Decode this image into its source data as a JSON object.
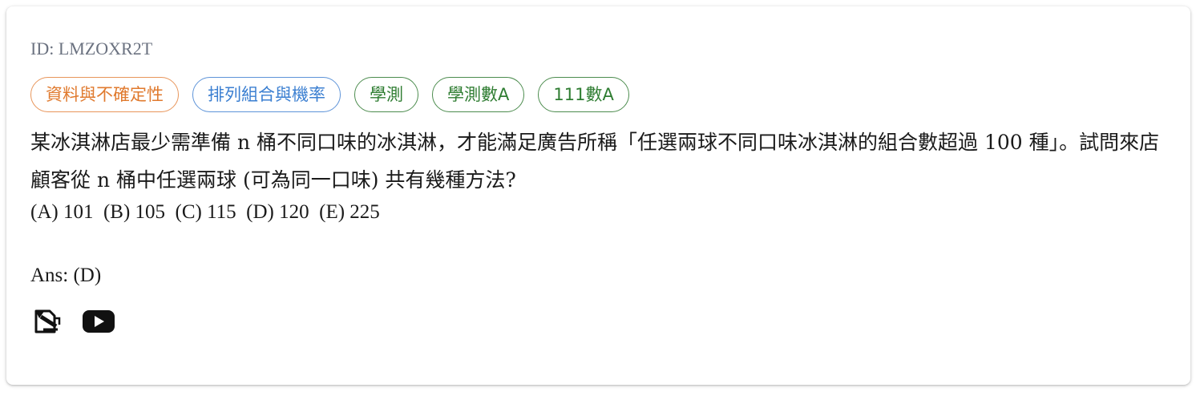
{
  "question": {
    "id_label": "ID: LMZOXR2T",
    "tags": [
      {
        "label": "資料與不確定性",
        "color": "#e07a2e"
      },
      {
        "label": "排列組合與機率",
        "color": "#3b7fd1"
      },
      {
        "label": "學測",
        "color": "#2f7d32"
      },
      {
        "label": "學測數A",
        "color": "#2f7d32"
      },
      {
        "label": "111數A",
        "color": "#2f7d32"
      }
    ],
    "text": "某冰淇淋店最少需準備 n 桶不同口味的冰淇淋，才能滿足廣告所稱「任選兩球不同口味冰淇淋的組合數超過 100 種」。試問來店顧客從 n 桶中任選兩球 (可為同一口味) 共有幾種方法?",
    "options": "(A) 101  (B) 105  (C) 115  (D) 120  (E) 225",
    "answer": "Ans: (D)"
  },
  "actions": {
    "icons": [
      "edit-sketch-icon",
      "youtube-icon"
    ]
  }
}
